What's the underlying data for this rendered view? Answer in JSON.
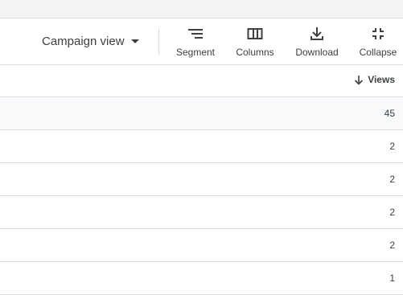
{
  "toolbar": {
    "campaign_view_label": "Campaign view",
    "tools": {
      "segment": "Segment",
      "columns": "Columns",
      "download": "Download",
      "collapse": "Collapse"
    }
  },
  "table": {
    "columns": [
      "Views"
    ],
    "sort_column": "Views",
    "sort_direction": "descending",
    "rows": [
      {
        "views": "45"
      },
      {
        "views": "2"
      },
      {
        "views": "2"
      },
      {
        "views": "2"
      },
      {
        "views": "2"
      },
      {
        "views": "1"
      }
    ]
  },
  "icons": {
    "caret": "caret-down-icon",
    "segment": "segment-icon",
    "columns": "columns-icon",
    "download": "download-icon",
    "collapse": "collapse-icon",
    "sort": "arrow-down-icon"
  },
  "colors": {
    "text": "#3c4043",
    "divider": "#dadce0",
    "top_strip": "#f1f3f4",
    "total_row": "#f8f9fa"
  }
}
